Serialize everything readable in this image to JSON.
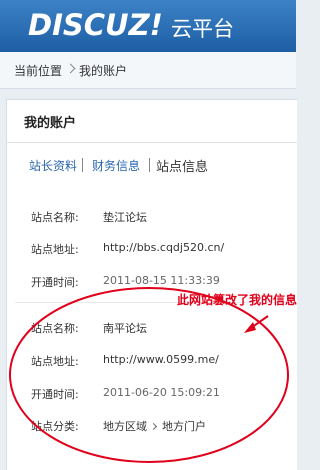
{
  "header": {
    "logo": "DISCUZ!",
    "platform": "云平台"
  },
  "breadcrumb": {
    "home": "当前位置",
    "current": "我的账户"
  },
  "panel": {
    "title": "我的账户",
    "tabs": [
      "站长资料",
      "财务信息",
      "站点信息"
    ],
    "site1": {
      "name_label": "站点名称:",
      "name": "垫江论坛",
      "url_label": "站点地址:",
      "url": "http://bbs.cqdj520.cn/",
      "time_label": "开通时间:",
      "time": "2011-08-15 11:33:39"
    },
    "site2": {
      "name_label": "站点名称:",
      "name": "南平论坛",
      "url_label": "站点地址:",
      "url": "http://www.0599.me/",
      "time_label": "开通时间:",
      "time": "2011-06-20 15:09:21",
      "cat_label": "站点分类:",
      "cat_1": "地方区域",
      "cat_2": "地方门户"
    }
  },
  "annotation": {
    "text": "此网站篡改了我的信息",
    "color": "#e0001b"
  }
}
